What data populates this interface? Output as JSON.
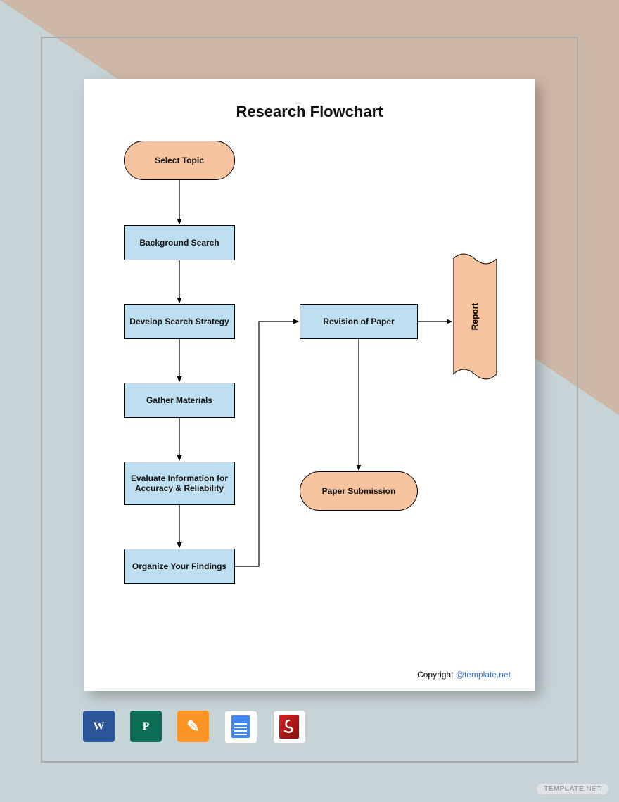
{
  "title": "Research Flowchart",
  "nodes": {
    "select_topic": "Select Topic",
    "background_search": "Background Search",
    "develop_strategy": "Develop Search Strategy",
    "gather_materials": "Gather Materials",
    "evaluate_info": "Evaluate Information for Accuracy & Reliability",
    "organize_findings": "Organize Your Findings",
    "revision_paper": "Revision of Paper",
    "paper_submission": "Paper Submission",
    "report": "Report"
  },
  "copyright": {
    "prefix": "Copyright ",
    "link": "@template.net"
  },
  "icons": {
    "word": "W",
    "publisher": "P",
    "pages": "✎"
  },
  "watermark": {
    "brand": "TEMPLATE",
    "tld": ".NET"
  }
}
